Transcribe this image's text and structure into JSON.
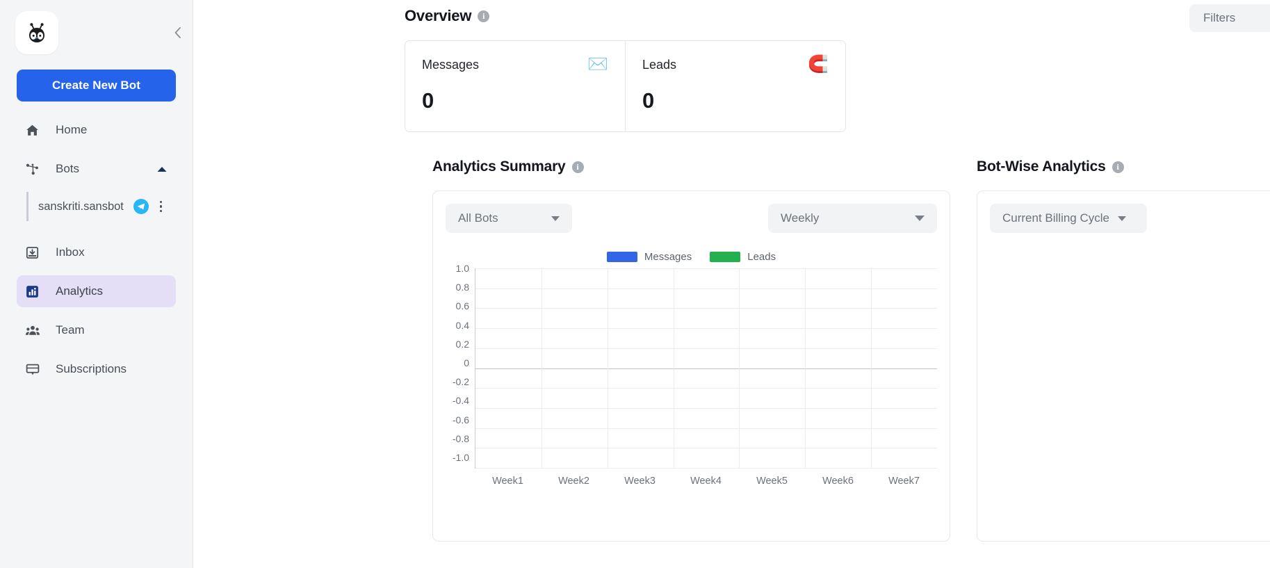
{
  "sidebar": {
    "logo_icon": "bot-logo-icon",
    "collapse_icon": "chevron-left-icon",
    "create_button": "Create New Bot",
    "items": [
      {
        "label": "Home",
        "icon": "home-icon",
        "active": false
      },
      {
        "label": "Bots",
        "icon": "bots-hierarchy-icon",
        "active": false,
        "caret": "chevron-up-icon"
      },
      {
        "label": "Inbox",
        "icon": "inbox-icon",
        "active": false
      },
      {
        "label": "Analytics",
        "icon": "analytics-bar-icon",
        "active": true
      },
      {
        "label": "Team",
        "icon": "team-people-icon",
        "active": false
      },
      {
        "label": "Subscriptions",
        "icon": "subscriptions-monitor-icon",
        "active": false
      }
    ],
    "bot_entry": {
      "name": "sanskriti.sansbot",
      "channel_icon": "telegram-icon",
      "menu_icon": "kebab-menu-icon"
    }
  },
  "header": {
    "filters_label": "Filters"
  },
  "overview": {
    "title": "Overview",
    "info_icon": "info-icon",
    "cards": [
      {
        "label": "Messages",
        "value": "0",
        "icon": "envelope-icon",
        "glyph": "✉️"
      },
      {
        "label": "Leads",
        "value": "0",
        "icon": "magnet-icon",
        "glyph": "🧲"
      }
    ]
  },
  "analytics_summary": {
    "title": "Analytics Summary",
    "info_icon": "info-icon",
    "bot_filter": {
      "value": "All Bots",
      "caret_icon": "chevron-down-icon"
    },
    "period_filter": {
      "value": "Weekly",
      "caret_icon": "chevron-down-icon"
    }
  },
  "bot_wise": {
    "title": "Bot-Wise Analytics",
    "info_icon": "info-icon",
    "cycle_filter": {
      "value": "Current Billing Cycle",
      "caret_icon": "chevron-down-icon"
    }
  },
  "colors": {
    "brand_blue": "#2563eb",
    "messages_blue": "#3366e6",
    "leads_green": "#22b14c",
    "active_nav_bg": "#e4def7",
    "sidebar_bg": "#f4f5f7"
  },
  "chart_data": {
    "type": "bar",
    "title": "Analytics Summary",
    "xlabel": "",
    "ylabel": "",
    "grid": true,
    "legend_position": "top-center",
    "categories": [
      "Week1",
      "Week2",
      "Week3",
      "Week4",
      "Week5",
      "Week6",
      "Week7"
    ],
    "ytick_labels": [
      "1.0",
      "0.8",
      "0.6",
      "0.4",
      "0.2",
      "0",
      "-0.2",
      "-0.4",
      "-0.6",
      "-0.8",
      "-1.0"
    ],
    "ylim": [
      -1.0,
      1.0
    ],
    "series": [
      {
        "name": "Messages",
        "color": "#3366e6",
        "values": [
          0,
          0,
          0,
          0,
          0,
          0,
          0
        ]
      },
      {
        "name": "Leads",
        "color": "#22b14c",
        "values": [
          0,
          0,
          0,
          0,
          0,
          0,
          0
        ]
      }
    ]
  }
}
